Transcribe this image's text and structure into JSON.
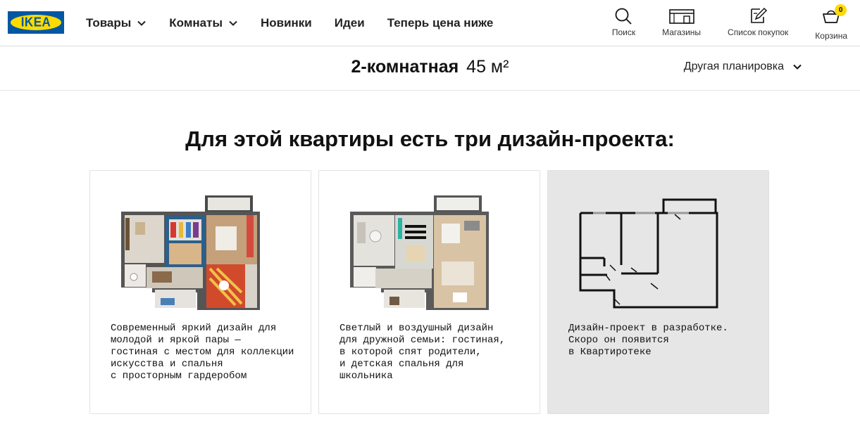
{
  "brand": {
    "logo_text": "IKEA",
    "blue": "#0058a3",
    "yellow": "#ffdb00"
  },
  "nav": {
    "items": [
      {
        "label": "Товары",
        "has_dropdown": true
      },
      {
        "label": "Комнаты",
        "has_dropdown": true
      },
      {
        "label": "Новинки",
        "has_dropdown": false
      },
      {
        "label": "Идеи",
        "has_dropdown": false
      },
      {
        "label": "Теперь цена ниже",
        "has_dropdown": false
      }
    ]
  },
  "tools": {
    "search": {
      "label": "Поиск",
      "icon": "search-icon"
    },
    "stores": {
      "label": "Магазины",
      "icon": "store-icon"
    },
    "shopping_list": {
      "label": "Список покупок",
      "icon": "shopping-list-icon"
    },
    "cart": {
      "label": "Корзина",
      "icon": "cart-icon",
      "count": "0"
    }
  },
  "plan": {
    "title": "2-комнатная",
    "area": "45 м²",
    "switch_label": "Другая планировка"
  },
  "heading": "Для этой квартиры есть три дизайн-проекта:",
  "cards": [
    {
      "description": "Современный яркий дизайн для\nмолодой и яркой пары —\nгостиная с местом для коллекции\nискусства и спальня\nс просторным гардеробом",
      "style": "bright"
    },
    {
      "description": "Светлый и воздушный дизайн\nдля дружной семьи: гостиная,\nв которой спят родители,\nи детская спальня для\nшкольника",
      "style": "light"
    },
    {
      "description": "Дизайн-проект в разработке.\nСкоро он появится\nв Квартиротеке",
      "style": "placeholder"
    }
  ]
}
